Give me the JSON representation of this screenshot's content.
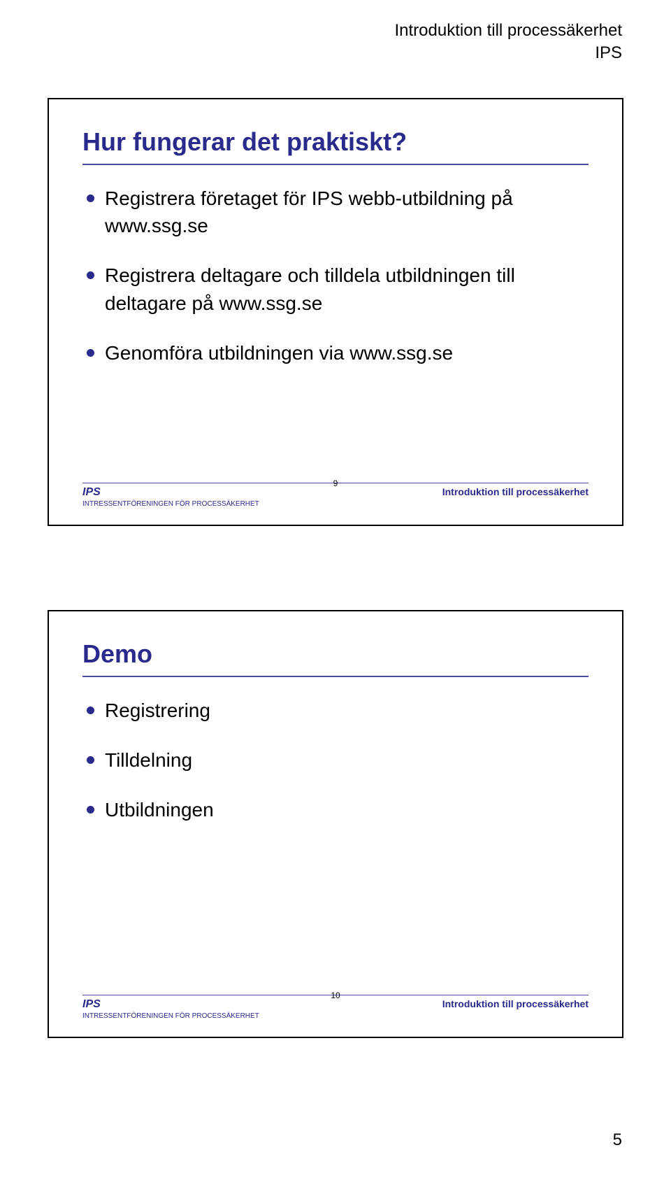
{
  "header": {
    "line1": "Introduktion till processäkerhet",
    "line2": "IPS"
  },
  "slides": [
    {
      "title": "Hur fungerar det praktiskt?",
      "bullets": [
        "Registrera företaget för IPS webb-utbildning på www.ssg.se",
        "Registrera deltagare och tilldela utbildningen till deltagare på www.ssg.se",
        "Genomföra utbildningen via www.ssg.se"
      ],
      "footer": {
        "brand": "IPS",
        "sub": "INTRESSENTFÖRENINGEN FÖR PROCESSÄKERHET",
        "num": "9",
        "ftitle": "Introduktion till processäkerhet"
      }
    },
    {
      "title": "Demo",
      "bullets": [
        "Registrering",
        "Tilldelning",
        "Utbildningen"
      ],
      "footer": {
        "brand": "IPS",
        "sub": "INTRESSENTFÖRENINGEN FÖR PROCESSÄKERHET",
        "num": "10",
        "ftitle": "Introduktion till processäkerhet"
      }
    }
  ],
  "page_number": "5"
}
